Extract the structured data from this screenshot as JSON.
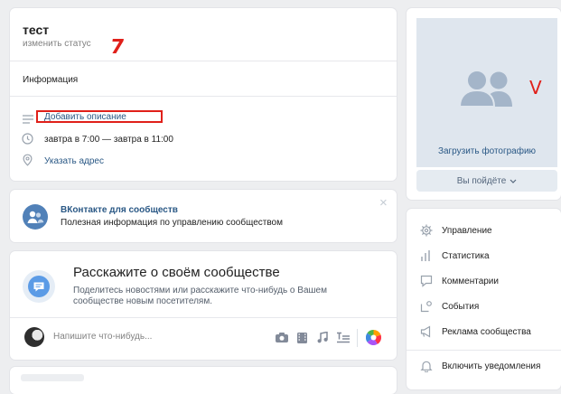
{
  "profile": {
    "name": "тест",
    "change_status": "изменить статус",
    "annotation_mark": "7"
  },
  "info": {
    "section_title": "Информация",
    "add_description": "Добавить описание",
    "time": "завтра в 7:00 — завтра в 11:00",
    "address": "Указать адрес"
  },
  "promo": {
    "title": "ВКонтакте для сообществ",
    "subtitle": "Полезная информация по управлению сообществом",
    "close": "×"
  },
  "tell": {
    "title": "Расскажите о своём сообществе",
    "subtitle": "Поделитесь новостями или расскажите что-нибудь о Вашем сообществе новым посетителям."
  },
  "post": {
    "placeholder": "Напишите что-нибудь..."
  },
  "sidebar": {
    "upload_photo": "Загрузить фотографию",
    "annotation_check": "V",
    "going_button": "Вы пойдёте",
    "menu": [
      {
        "label": "Управление",
        "icon": "gear-icon"
      },
      {
        "label": "Статистика",
        "icon": "stats-icon"
      },
      {
        "label": "Комментарии",
        "icon": "comments-icon"
      },
      {
        "label": "События",
        "icon": "events-icon"
      },
      {
        "label": "Реклама сообщества",
        "icon": "ads-icon"
      },
      {
        "label": "Включить уведомления",
        "icon": "bell-icon"
      }
    ]
  },
  "colors": {
    "link": "#2a5885",
    "annotation_red": "#e0201a",
    "avatar_bg": "#dfe6ee",
    "avatar_silhouette": "#a4b5c9"
  }
}
